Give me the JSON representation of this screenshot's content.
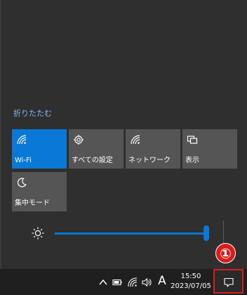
{
  "action_center": {
    "collapse_label": "折りたたむ",
    "tiles": [
      {
        "label": "Wi-Fi",
        "icon": "wifi-icon",
        "state": "on"
      },
      {
        "label": "すべての設定",
        "icon": "gear-icon",
        "state": "off"
      },
      {
        "label": "ネットワーク",
        "icon": "network-icon",
        "state": "off"
      },
      {
        "label": "表示",
        "icon": "display-icon",
        "state": "off"
      },
      {
        "label": "集中モード",
        "icon": "moon-icon",
        "state": "off"
      }
    ],
    "brightness": {
      "icon": "brightness-icon",
      "level": 1.0
    }
  },
  "taskbar": {
    "tray_icons": [
      "chevron-up-icon",
      "battery-icon",
      "wifi-icon",
      "volume-icon"
    ],
    "ime": "A",
    "clock": {
      "time": "15:50",
      "date": "2023/07/05"
    },
    "notification_button": {
      "icon": "notification-icon",
      "highlighted": true
    }
  },
  "annotation": {
    "badge_text": "①"
  },
  "colors": {
    "panel_bg": "#2f2f2f",
    "tile_bg": "#555555",
    "tile_active_bg": "#0a78d7",
    "accent": "#0a78d7",
    "link": "#7fb9ff",
    "taskbar_bg": "#1f1f1f",
    "highlight_red": "#d91c1c"
  }
}
